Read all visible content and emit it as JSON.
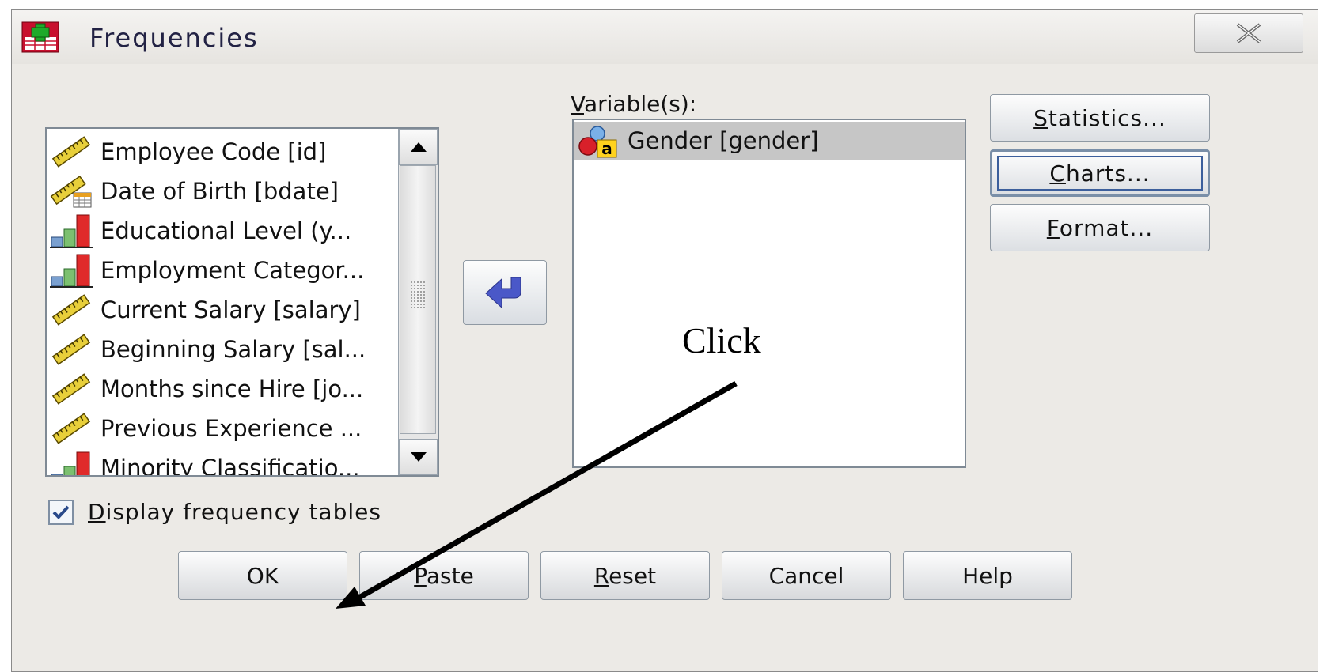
{
  "dialog": {
    "title": "Frequencies",
    "close_label": "X"
  },
  "source_list": {
    "items": [
      {
        "label": "Employee Code [id]",
        "icon": "scale-ruler-icon"
      },
      {
        "label": "Date of Birth [bdate]",
        "icon": "date-ruler-icon"
      },
      {
        "label": "Educational Level (y...",
        "icon": "ordinal-bars-icon"
      },
      {
        "label": "Employment Categor...",
        "icon": "ordinal-bars-icon"
      },
      {
        "label": "Current Salary [salary]",
        "icon": "scale-ruler-icon"
      },
      {
        "label": "Beginning Salary [sal...",
        "icon": "scale-ruler-icon"
      },
      {
        "label": "Months since Hire [jo...",
        "icon": "scale-ruler-icon"
      },
      {
        "label": "Previous Experience ...",
        "icon": "scale-ruler-icon"
      },
      {
        "label": "Minority Classificatio...",
        "icon": "ordinal-bars-icon"
      }
    ]
  },
  "target": {
    "label_underlined": "V",
    "label_rest": "ariable(s):",
    "items": [
      {
        "label": "Gender [gender]",
        "icon": "nominal-string-icon"
      }
    ]
  },
  "side_buttons": [
    {
      "u": "S",
      "rest": "tatistics...",
      "focused": false
    },
    {
      "u": "C",
      "rest": "harts...",
      "focused": true
    },
    {
      "u": "F",
      "rest": "ormat...",
      "focused": false
    }
  ],
  "checkbox": {
    "u": "D",
    "rest": "isplay frequency tables",
    "checked": true
  },
  "bottom_buttons": [
    {
      "u": "",
      "rest": "OK"
    },
    {
      "u": "P",
      "rest": "aste"
    },
    {
      "u": "R",
      "rest": "eset"
    },
    {
      "u": "",
      "rest": "Cancel"
    },
    {
      "u": "",
      "rest": "Help"
    }
  ],
  "annotation": {
    "text": "Click"
  },
  "colors": {
    "dialog_bg": "#eceae6",
    "arrow_blue": "#4a58c8",
    "selection_gray": "#c6c6c6",
    "title_text": "#222244"
  }
}
